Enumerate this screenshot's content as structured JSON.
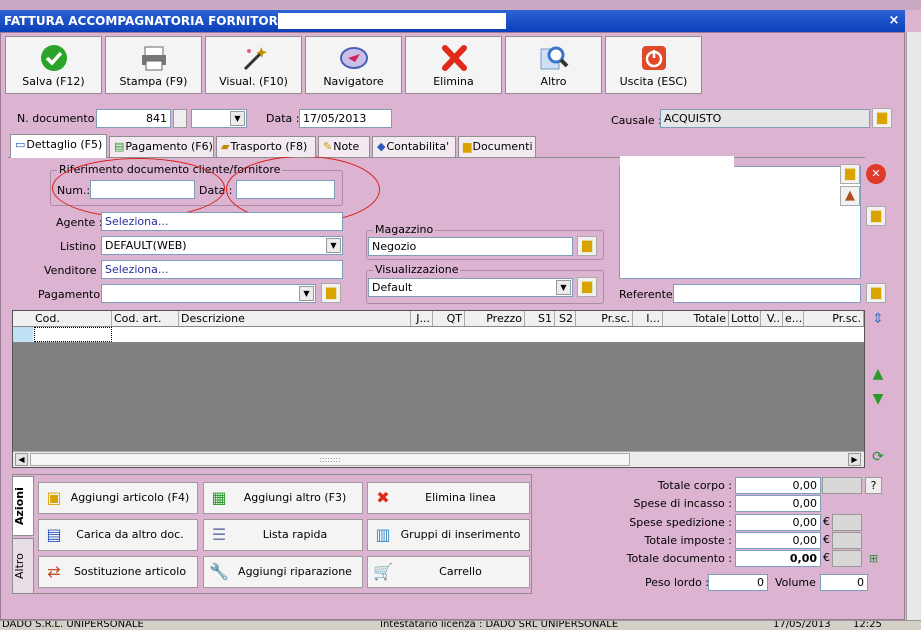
{
  "window": {
    "title": "FATTURA ACCOMPAGNATORIA FORNITORE N.",
    "close": "×"
  },
  "toolbar": [
    {
      "label": "Salva (F12)",
      "icon": "check-icon",
      "color": "#2aa52a"
    },
    {
      "label": "Stampa (F9)",
      "icon": "printer-icon",
      "color": "#777777"
    },
    {
      "label": "Visual. (F10)",
      "icon": "magic-wand-icon",
      "color": "#c08a00"
    },
    {
      "label": "Navigatore",
      "icon": "navigator-icon",
      "color": "#4a5fb5"
    },
    {
      "label": "Elimina",
      "icon": "delete-x-icon",
      "color": "#e02a1a"
    },
    {
      "label": "Altro",
      "icon": "magnifier-icon",
      "color": "#3a76c8"
    },
    {
      "label": "Uscita (ESC)",
      "icon": "power-icon",
      "color": "#e04a2a"
    }
  ],
  "header": {
    "ndoc_label": "N. documento :",
    "ndoc_value": "841",
    "data_label": "Data :",
    "data_value": "17/05/2013",
    "causale_label": "Causale :",
    "causale_value": "ACQUISTO"
  },
  "tabs": [
    {
      "label": "Dettaglio (F5)",
      "selected": true
    },
    {
      "label": "Pagamento (F6)"
    },
    {
      "label": "Trasporto (F8)"
    },
    {
      "label": "Note"
    },
    {
      "label": "Contabilita'"
    },
    {
      "label": "Documenti"
    }
  ],
  "riferimento": {
    "title": "Riferimento documento cliente/fornitore",
    "num_label": "Num.:",
    "num_value": "",
    "data_label": "Data :",
    "data_value": ""
  },
  "form": {
    "agente_label": "Agente :",
    "agente_value": "Seleziona...",
    "listino_label": "Listino :",
    "listino_value": "DEFAULT(WEB)",
    "venditore_label": "Venditore :",
    "venditore_value": "Seleziona...",
    "pagamento_label": "Pagamento :",
    "pagamento_value": "",
    "magazzino_title": "Magazzino",
    "magazzino_value": "Negozio",
    "visualizzazione_title": "Visualizzazione",
    "visualizzazione_value": "Default",
    "referente_label": "Referente",
    "referente_value": ""
  },
  "grid": {
    "columns": [
      "Cod.",
      "Cod. art.",
      "Descrizione",
      "J...",
      "QT",
      "Prezzo",
      "S1",
      "S2",
      "Pr.sc.",
      "I...",
      "Totale",
      "Lotto",
      "V..",
      "e...",
      "Pr.sc."
    ],
    "scroll_grip": "::::::::"
  },
  "side_tabs": [
    "Azioni",
    "Altro"
  ],
  "actions": [
    {
      "label": "Aggiungi articolo (F4)",
      "icon": "add-article-icon",
      "glyph": "▣"
    },
    {
      "label": "Aggiungi altro (F3)",
      "icon": "add-other-icon",
      "glyph": "▦"
    },
    {
      "label": "Elimina linea",
      "icon": "delete-line-icon",
      "glyph": "✖"
    },
    {
      "label": "Carica da altro doc.",
      "icon": "load-doc-icon",
      "glyph": "▤"
    },
    {
      "label": "Lista rapida",
      "icon": "quick-list-icon",
      "glyph": "☰"
    },
    {
      "label": "Gruppi di inserimento",
      "icon": "groups-icon",
      "glyph": "▥"
    },
    {
      "label": "Sostituzione articolo",
      "icon": "replace-icon",
      "glyph": "⇄"
    },
    {
      "label": "Aggiungi riparazione",
      "icon": "wrench-icon",
      "glyph": "🔧"
    },
    {
      "label": "Carrello",
      "icon": "cart-icon",
      "glyph": "🛒"
    }
  ],
  "totals": {
    "corpo_label": "Totale corpo :",
    "corpo_value": "0,00",
    "help": "?",
    "incasso_label": "Spese di incasso :",
    "incasso_value": "0,00",
    "spedizione_label": "Spese spedizione :",
    "spedizione_value": "0,00",
    "imposte_label": "Totale imposte :",
    "imposte_value": "0,00",
    "documento_label": "Totale documento :",
    "documento_value": "0,00",
    "euro": "€",
    "peso_label": "Peso lordo :",
    "peso_value": "0",
    "volume_label": "Volume :",
    "volume_value": "0"
  },
  "status": {
    "left": "DADO S.R.L. UNIPERSONALE",
    "center": "Intestatario licenza : DADO SRL UNIPERSONALE",
    "date": "17/05/2013",
    "time": "12:25"
  }
}
